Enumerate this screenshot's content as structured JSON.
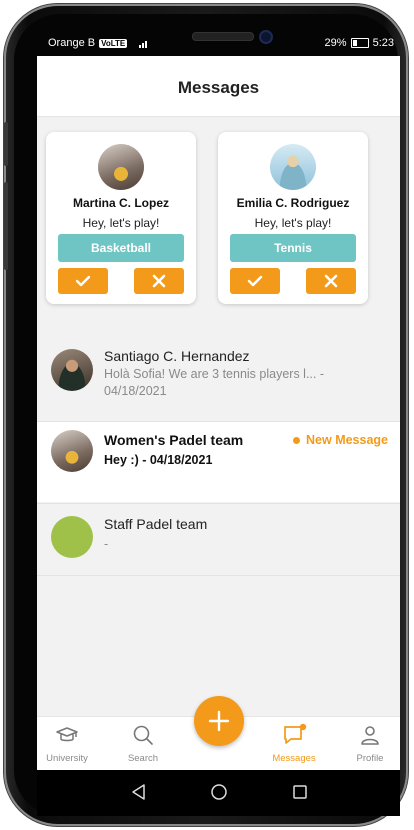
{
  "status_bar": {
    "carrier": "Orange B",
    "network_badge": "VoLTE",
    "battery": "29%",
    "time": "5:23"
  },
  "header": {
    "title": "Messages"
  },
  "requests": [
    {
      "name": "Martina C. Lopez",
      "message": "Hey, let's play!",
      "sport": "Basketball"
    },
    {
      "name": "Emilia C. Rodriguez",
      "message": "Hey, let's play!",
      "sport": "Tennis"
    }
  ],
  "conversations": [
    {
      "name": "Santiago C. Hernandez",
      "preview_line1": "Holà Sofia! We are 3 tennis players l... -",
      "preview_line2": "04/18/2021"
    },
    {
      "name": "Women's Padel team",
      "preview_line1": "Hey :) - 04/18/2021",
      "badge": "New Message"
    },
    {
      "name": "Staff Padel team",
      "preview_line1": "-"
    }
  ],
  "nav": [
    {
      "label": "University",
      "icon": "graduation-cap-icon"
    },
    {
      "label": "Search",
      "icon": "search-icon"
    },
    {
      "label": "Messages",
      "icon": "chat-icon",
      "active": true
    },
    {
      "label": "Profile",
      "icon": "profile-icon"
    }
  ],
  "colors": {
    "accent": "#f39a1a",
    "teal": "#6ec5c3",
    "green_avatar": "#9fc14a"
  }
}
